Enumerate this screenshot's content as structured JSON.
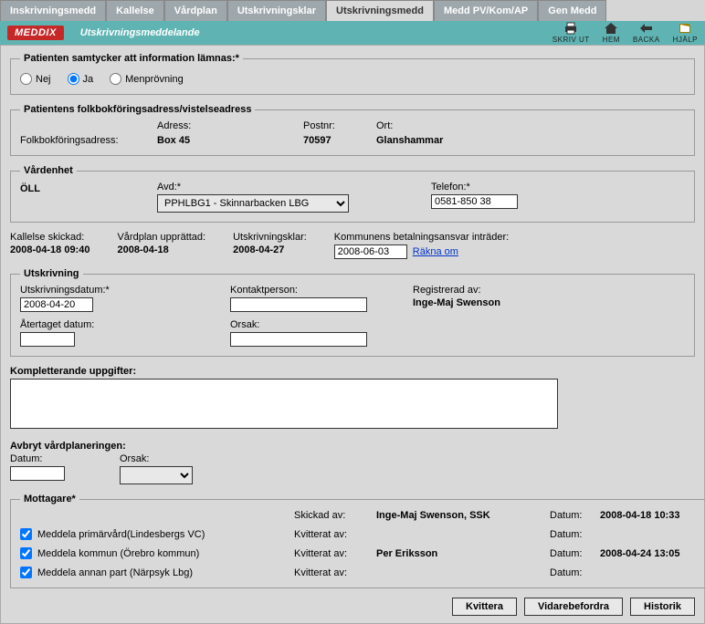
{
  "tabs": [
    {
      "label": "Inskrivningsmedd"
    },
    {
      "label": "Kallelse"
    },
    {
      "label": "Vårdplan"
    },
    {
      "label": "Utskrivningsklar"
    },
    {
      "label": "Utskrivningsmedd",
      "active": true
    },
    {
      "label": "Medd PV/Kom/AP"
    },
    {
      "label": "Gen Medd"
    }
  ],
  "logo": "MEDDIX",
  "titlebar_title": "Utskrivningsmeddelande",
  "icons": {
    "print": "SKRIV UT",
    "home": "HEM",
    "back": "BACKA",
    "help": "HJÄLP"
  },
  "consent": {
    "legend": "Patienten samtycker att information lämnas:*",
    "options": {
      "nej": "Nej",
      "ja": "Ja",
      "men": "Menprövning"
    },
    "selected": "ja"
  },
  "address": {
    "legend": "Patientens folkbokföringsadress/vistelseadress",
    "headers": {
      "adress": "Adress:",
      "postnr": "Postnr:",
      "ort": "Ort:"
    },
    "row_label": "Folkbokföringsadress:",
    "adress": "Box 45",
    "postnr": "70597",
    "ort": "Glanshammar"
  },
  "vardenhet": {
    "legend": "Vårdenhet",
    "oll_label": "ÖLL",
    "avd_label": "Avd:*",
    "avd_value": "PPHLBG1 - Skinnarbacken LBG",
    "tel_label": "Telefon:*",
    "tel_value": "0581-850 38"
  },
  "dates": {
    "kallelse_label": "Kallelse skickad:",
    "kallelse_value": "2008-04-18 09:40",
    "vardplan_label": "Vårdplan upprättad:",
    "vardplan_value": "2008-04-18",
    "utklar_label": "Utskrivningsklar:",
    "utklar_value": "2008-04-27",
    "kommun_label": "Kommunens betalningsansvar inträder:",
    "kommun_value": "2008-06-03",
    "rakna_om": "Räkna om"
  },
  "utskrivning": {
    "legend": "Utskrivning",
    "datum_label": "Utskrivningsdatum:*",
    "datum_value": "2008-04-20",
    "kontakt_label": "Kontaktperson:",
    "kontakt_value": "",
    "reg_label": "Registrerad av:",
    "reg_value": "Inge-Maj Swenson",
    "atertag_label": "Återtaget datum:",
    "atertag_value": "",
    "orsak_label": "Orsak:",
    "orsak_value": ""
  },
  "komp_label": "Kompletterande uppgifter:",
  "komp_value": "",
  "avbryt": {
    "header": "Avbryt vårdplaneringen:",
    "datum_label": "Datum:",
    "datum_value": "",
    "orsak_label": "Orsak:"
  },
  "mottagare": {
    "legend": "Mottagare*",
    "skickad_label": "Skickad av:",
    "skickad_value": "Inge-Maj Swenson, SSK",
    "skickad_datum_label": "Datum:",
    "skickad_datum_value": "2008-04-18 10:33",
    "rows": [
      {
        "chk": true,
        "label": "Meddela primärvård(Lindesbergs VC)",
        "kvitt_label": "Kvitterat av:",
        "kvitt_by": "",
        "datum_label": "Datum:",
        "datum": ""
      },
      {
        "chk": true,
        "label": "Meddela kommun (Örebro kommun)",
        "kvitt_label": "Kvitterat av:",
        "kvitt_by": "Per Eriksson",
        "datum_label": "Datum:",
        "datum": "2008-04-24 13:05"
      },
      {
        "chk": true,
        "label": "Meddela annan part (Närpsyk Lbg)",
        "kvitt_label": "Kvitterat av:",
        "kvitt_by": "",
        "datum_label": "Datum:",
        "datum": ""
      }
    ]
  },
  "buttons": {
    "kvittera": "Kvittera",
    "vidare": "Vidarebefordra",
    "historik": "Historik"
  }
}
